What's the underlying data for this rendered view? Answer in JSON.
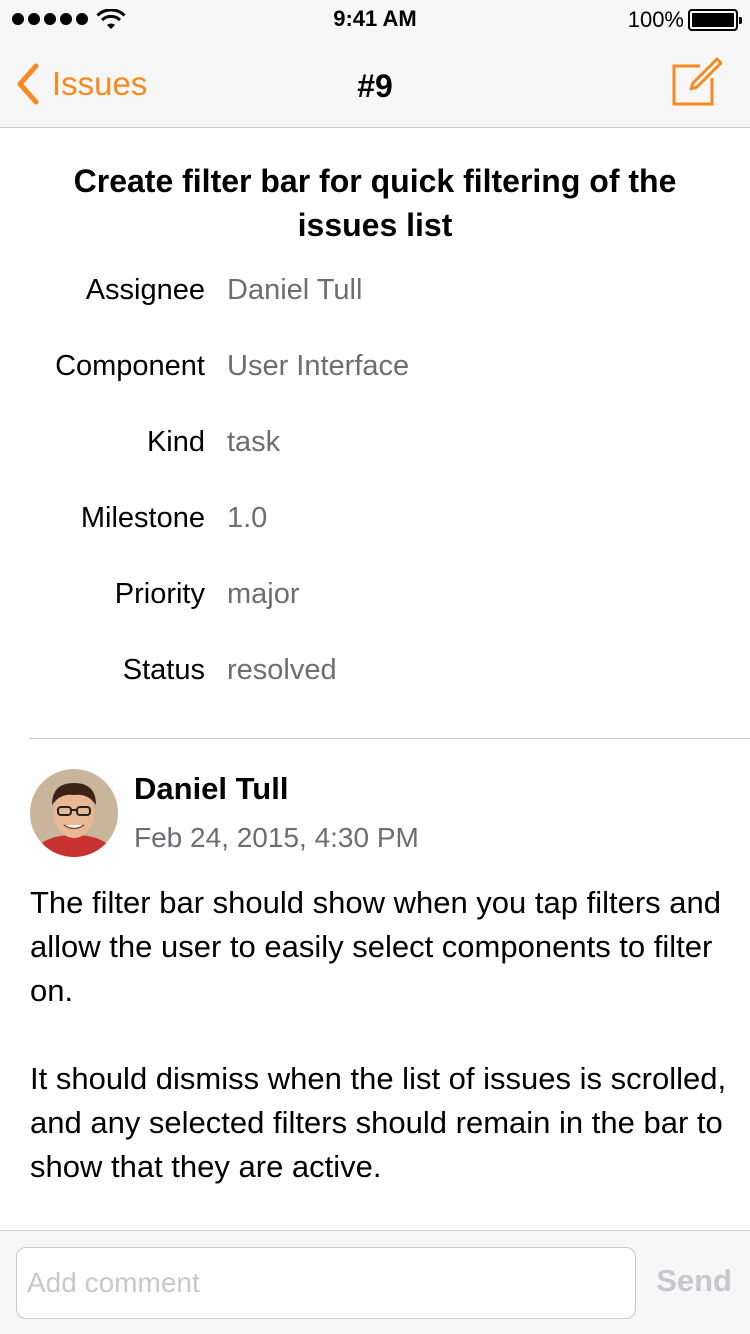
{
  "status_bar": {
    "time": "9:41 AM",
    "battery_percent": "100%",
    "signal_bars": 5,
    "battery_level": 1.0
  },
  "nav": {
    "back_label": "Issues",
    "title": "#9",
    "back_icon": "chevron-left-icon",
    "compose_icon": "compose-icon",
    "accent_color": "#f7891e"
  },
  "issue": {
    "title": "Create filter bar for quick filtering of the issues list",
    "fields": [
      {
        "label": "Assignee",
        "value": "Daniel Tull"
      },
      {
        "label": "Component",
        "value": "User Interface"
      },
      {
        "label": "Kind",
        "value": "task"
      },
      {
        "label": "Milestone",
        "value": "1.0"
      },
      {
        "label": "Priority",
        "value": "major"
      },
      {
        "label": "Status",
        "value": "resolved"
      }
    ]
  },
  "comment": {
    "author": "Daniel Tull",
    "date": "Feb 24, 2015, 4:30 PM",
    "paragraphs": [
      "The filter bar should show when you tap filters and allow the user to easily select components to filter on.",
      "It should dismiss when the list of issues is scrolled, and any selected filters should remain in the bar to show that they are active."
    ]
  },
  "composer": {
    "placeholder": "Add comment",
    "value": "",
    "send_label": "Send"
  }
}
